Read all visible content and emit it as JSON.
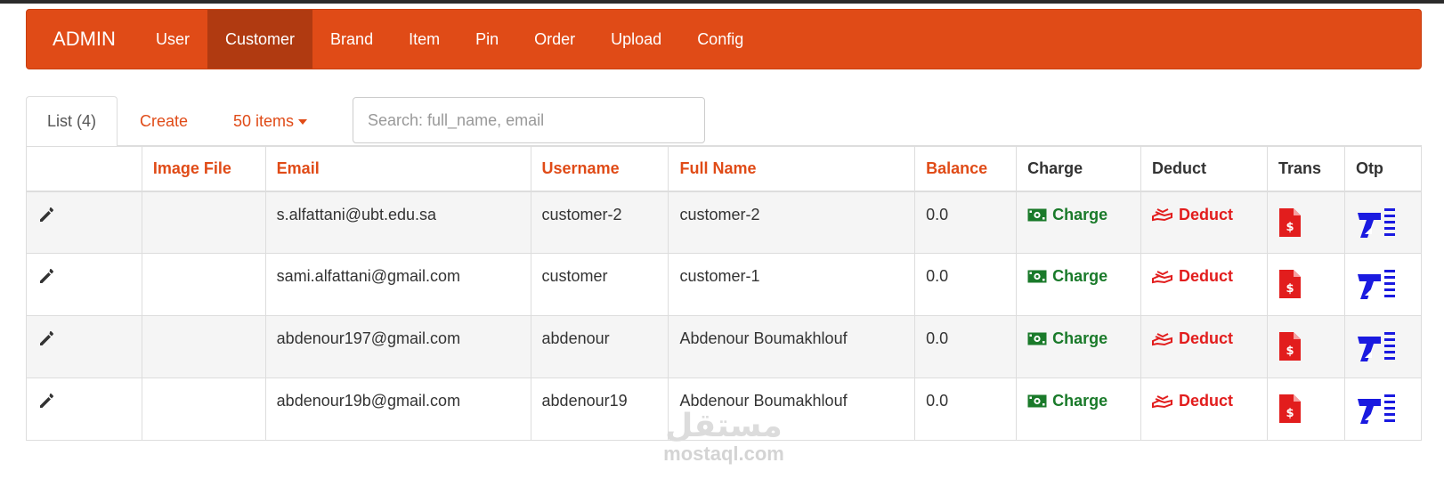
{
  "navbar": {
    "brand": "ADMIN",
    "items": [
      {
        "label": "User",
        "active": false
      },
      {
        "label": "Customer",
        "active": true
      },
      {
        "label": "Brand",
        "active": false
      },
      {
        "label": "Item",
        "active": false
      },
      {
        "label": "Pin",
        "active": false
      },
      {
        "label": "Order",
        "active": false
      },
      {
        "label": "Upload",
        "active": false
      },
      {
        "label": "Config",
        "active": false
      }
    ],
    "color": "#e04b17",
    "active_color": "#b03a11"
  },
  "tabs": {
    "list_label": "List (4)",
    "create_label": "Create",
    "page_size_label": "50 items"
  },
  "search": {
    "placeholder": "Search: full_name, email",
    "value": ""
  },
  "table": {
    "columns": [
      "",
      "Image File",
      "Email",
      "Username",
      "Full Name",
      "Balance",
      "Charge",
      "Deduct",
      "Trans",
      "Otp"
    ],
    "rows": [
      {
        "image_file": "",
        "email": "s.alfattani@ubt.edu.sa",
        "username": "customer-2",
        "full_name": "customer-2",
        "balance": "0.0",
        "charge": "Charge",
        "deduct": "Deduct"
      },
      {
        "image_file": "",
        "email": "sami.alfattani@gmail.com",
        "username": "customer",
        "full_name": "customer-1",
        "balance": "0.0",
        "charge": "Charge",
        "deduct": "Deduct"
      },
      {
        "image_file": "",
        "email": "abdenour197@gmail.com",
        "username": "abdenour",
        "full_name": "Abdenour Boumakhlouf",
        "balance": "0.0",
        "charge": "Charge",
        "deduct": "Deduct"
      },
      {
        "image_file": "",
        "email": "abdenour19b@gmail.com",
        "username": "abdenour19",
        "full_name": "Abdenour Boumakhlouf",
        "balance": "0.0",
        "charge": "Charge",
        "deduct": "Deduct"
      }
    ],
    "icons": {
      "edit": "pencil-icon",
      "charge": "money-bill-icon",
      "deduct": "deduct-hand-icon",
      "trans": "file-invoice-dollar-icon",
      "otp": "text-list-icon"
    },
    "colors": {
      "charge": "#1a7a2a",
      "deduct": "#e21d1d",
      "otp": "#1a1ae0",
      "header_sort": "#e04b17"
    }
  },
  "watermark": {
    "arabic": "مستقل",
    "latin": "mostaql.com"
  }
}
